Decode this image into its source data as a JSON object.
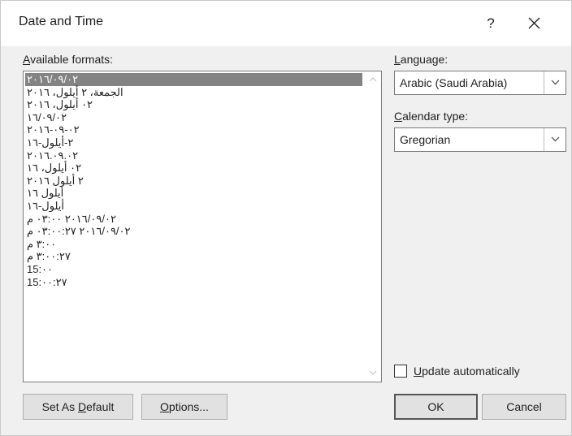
{
  "window": {
    "title": "Date and Time",
    "help_glyph": "?",
    "close_icon": "close-icon"
  },
  "formats": {
    "label_mnemonic": "A",
    "label_rest": "vailable formats:",
    "items": [
      "٢٠١٦/٠٩/٠٢",
      "الجمعة، ٢ أيلول، ٢٠١٦",
      "٠٢ أيلول، ٢٠١٦",
      "١٦/٠٩/٠٢",
      "٠٢-٠٩-٢٠١٦",
      "٢-أيلول-١٦",
      "٢٠١٦.٠٩.٠٢",
      "٠٢ أيلول، ١٦",
      "٢ أيلول ٢٠١٦",
      "أيلول ١٦",
      "أيلول-١٦",
      "٢٠١٦/٠٩/٠٢ ٠٣:٠٠ م",
      "٢٠١٦/٠٩/٠٢ ٠٣:٠٠:٢٧ م",
      "٣:٠٠ م",
      "٣:٠٠:٢٧ م",
      "15:٠٠",
      "15:٠٠:٢٧"
    ],
    "selected_index": 0
  },
  "language": {
    "label_mnemonic": "L",
    "label_rest": "anguage:",
    "value": "Arabic (Saudi Arabia)"
  },
  "calendar": {
    "label_mnemonic": "C",
    "label_rest": "alendar type:",
    "value": "Gregorian"
  },
  "update_auto": {
    "label_mnemonic": "U",
    "label_rest": "pdate automatically",
    "checked": false
  },
  "buttons": {
    "set_default_pre": "Set As ",
    "set_default_mnemonic": "D",
    "set_default_post": "efault",
    "options_mnemonic": "O",
    "options_rest": "ptions...",
    "ok": "OK",
    "cancel": "Cancel"
  }
}
